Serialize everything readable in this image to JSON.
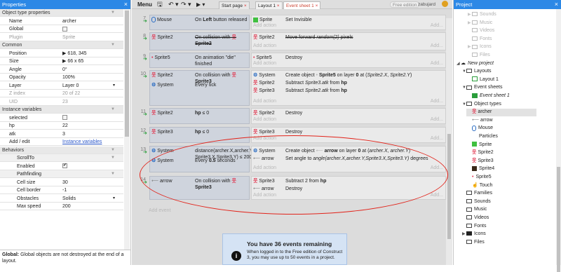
{
  "properties": {
    "title": "Properties",
    "close": "×",
    "rows": [
      {
        "type": "sec",
        "k": "Object type properties"
      },
      {
        "k": "Name",
        "v": "archer"
      },
      {
        "k": "Global",
        "cb": ""
      },
      {
        "k": "Plugin",
        "v": "Sprite",
        "dim": true
      },
      {
        "type": "sec",
        "k": "Common"
      },
      {
        "k": "Position",
        "v": "▶ 618, 345"
      },
      {
        "k": "Size",
        "v": "▶ 66 x 65"
      },
      {
        "k": "Angle",
        "v": "0°"
      },
      {
        "k": "Opacity",
        "v": "100%"
      },
      {
        "k": "Layer",
        "v": "Layer 0",
        "dd": "▾"
      },
      {
        "k": "Z index",
        "v": "20 of 22",
        "dim": true
      },
      {
        "k": "UID",
        "v": "23",
        "dim": true
      },
      {
        "type": "sec",
        "k": "Instance variables"
      },
      {
        "k": "selected",
        "cb": ""
      },
      {
        "k": "hp",
        "v": "22"
      },
      {
        "k": "atk",
        "v": "3"
      },
      {
        "k": "Add / edit",
        "link": "Instance variables"
      },
      {
        "type": "sec",
        "k": "Behaviors"
      },
      {
        "type": "subsec",
        "k": "ScrollTo"
      },
      {
        "k": "Enabled",
        "cb": "✔",
        "sub": true
      },
      {
        "type": "subsec",
        "k": "Pathfinding"
      },
      {
        "k": "Cell size",
        "v": "30",
        "sub": true
      },
      {
        "k": "Cell border",
        "v": "-1",
        "sub": true
      },
      {
        "k": "Obstacles",
        "v": "Solids",
        "dd": "▾",
        "sub": true
      },
      {
        "k": "Max speed",
        "v": "200",
        "sub": true
      }
    ],
    "footer_bold": "Global:",
    "footer_text": " Global objects are not destroyed at the end of a layout."
  },
  "toolbar": {
    "menu": "Menu",
    "save": "🖫",
    "undo": "↶ ▾",
    "redo": "↷ ▾",
    "run": "▶ ▾",
    "tabs": [
      {
        "label": "Start page",
        "close": "×"
      },
      {
        "label": "Layout 1",
        "close": "×"
      },
      {
        "label": "Event sheet 1",
        "close": "×"
      }
    ],
    "free_edition": "Free edition",
    "user": "zabujard"
  },
  "events": [
    {
      "n": "7",
      "conds": [
        {
          "ico": "mouse",
          "obj": "Mouse",
          "text": "On <b>Left</b> button released"
        }
      ],
      "acts": [
        {
          "ico": "sprite",
          "obj": "Sprite",
          "text": "Set Invisible"
        }
      ]
    },
    {
      "n": "8",
      "conds": [
        {
          "ico": "fig",
          "obj": "Sprite2",
          "text": "On collision with <span class=fig>웃</span><br><b>Sprite2</b>",
          "strike": true
        }
      ],
      "acts": [
        {
          "ico": "fig",
          "obj": "Sprite2",
          "text": "Move forward <i>random(2)</i> pixels",
          "strike": true
        }
      ]
    },
    {
      "n": "9",
      "conds": [
        {
          "ico": "dot",
          "obj": "Sprite5",
          "text": "On animation \"die\"<br>finished"
        }
      ],
      "acts": [
        {
          "ico": "dot",
          "obj": "Sprite5",
          "text": "Destroy"
        }
      ]
    },
    {
      "n": "10",
      "conds": [
        {
          "ico": "fig",
          "obj": "Sprite2",
          "text": "On collision with <span class=fig>웃</span><br><b>Sprite3</b>"
        },
        {
          "ico": "gear",
          "obj": "System",
          "text": "Every tick"
        }
      ],
      "acts": [
        {
          "ico": "gear",
          "obj": "System",
          "text": "Create object <span class=dim2>•</span> <b>Sprite5</b> on layer <b>0</b> at (<i>Sprite2.X</i>, <i>Sprite2.Y</i>)"
        },
        {
          "ico": "fig",
          "obj": "Sprite2",
          "text": "Subtract <i>Sprite3.atk</i> from <b>hp</b>"
        },
        {
          "ico": "fig",
          "obj": "Sprite3",
          "text": "Subtract <i>Sprite2.atk</i> from <b>hp</b>"
        }
      ]
    },
    {
      "n": "11",
      "conds": [
        {
          "ico": "fig",
          "obj": "Sprite2",
          "text": "<b>hp</b> ≤ 0"
        }
      ],
      "acts": [
        {
          "ico": "fig",
          "obj": "Sprite2",
          "text": "Destroy"
        }
      ]
    },
    {
      "n": "12",
      "conds": [
        {
          "ico": "fig",
          "obj": "Sprite3",
          "text": "<b>hp</b> ≤ 0"
        }
      ],
      "acts": [
        {
          "ico": "fig",
          "obj": "Sprite3",
          "text": "Destroy"
        }
      ]
    },
    {
      "n": "13",
      "conds": [
        {
          "ico": "gear",
          "obj": "System",
          "text": "distance(archer.X,archer.Y,<br>Sprite3.X,Sprite3.Y) ≤ 200"
        },
        {
          "ico": "gear",
          "obj": "System",
          "text": "Every <b>0.5</b> seconds"
        }
      ],
      "acts": [
        {
          "ico": "gear",
          "obj": "System",
          "text": "Create object <span class=dim2>⟵</span> <b>arrow</b> on layer <b>0</b> at (<i>archer.X</i>, <i>archer.Y</i>)"
        },
        {
          "ico": "arrow",
          "obj": "arrow",
          "text": "Set angle to <i>angle(archer.X,archer.Y,Sprite3.X,Sprite3.Y)</i> degrees"
        }
      ]
    },
    {
      "n": "14",
      "conds": [
        {
          "ico": "arrow",
          "obj": "arrow",
          "text": "On collision with <span class=fig>웃</span><br><b>Sprite3</b>"
        }
      ],
      "acts": [
        {
          "ico": "fig",
          "obj": "Sprite3",
          "text": "Subtract 2 from <b>hp</b>"
        },
        {
          "ico": "arrow",
          "obj": "arrow",
          "text": "Destroy"
        }
      ]
    }
  ],
  "add_action": "Add action",
  "add_event": "Add event",
  "add_right": "Add...",
  "notice": {
    "title": "You have 36 events remaining",
    "text": "When logged in to the Free edition of Construct 3, you may use up to 50 events in a project.",
    "icon": "i"
  },
  "project": {
    "title": "Project",
    "close": "×",
    "items": [
      {
        "label": "Sounds",
        "d": 2,
        "dim": true,
        "caret": "▶"
      },
      {
        "label": "Music",
        "d": 2,
        "dim": true,
        "caret": "▶"
      },
      {
        "label": "Videos",
        "d": 2,
        "dim": true
      },
      {
        "label": "Fonts",
        "d": 2,
        "dim": true
      },
      {
        "label": "Icons",
        "d": 2,
        "dim": true,
        "caret": "▶"
      },
      {
        "label": "Files",
        "d": 2,
        "dim": true
      },
      {
        "label": "New project",
        "d": 0,
        "caret": "◢",
        "it": true,
        "ico": "cloud"
      },
      {
        "label": "Layouts",
        "d": 1,
        "caret": "▼"
      },
      {
        "label": "Layout 1",
        "d": 2,
        "ico": "layout"
      },
      {
        "label": "Event sheets",
        "d": 1,
        "caret": "▼"
      },
      {
        "label": "Event sheet 1",
        "d": 2,
        "ico": "sheet",
        "it": true
      },
      {
        "label": "Object types",
        "d": 1,
        "caret": "▼"
      },
      {
        "label": "archer",
        "d": 2,
        "ico": "fig",
        "sel": true
      },
      {
        "label": "arrow",
        "d": 2,
        "ico": "arrow"
      },
      {
        "label": "Mouse",
        "d": 2,
        "ico": "mouse"
      },
      {
        "label": "Particles",
        "d": 2,
        "ico": "none"
      },
      {
        "label": "Sprite",
        "d": 2,
        "ico": "green"
      },
      {
        "label": "Sprite2",
        "d": 2,
        "ico": "fig"
      },
      {
        "label": "Sprite3",
        "d": 2,
        "ico": "fig"
      },
      {
        "label": "Sprite4",
        "d": 2,
        "ico": "dark"
      },
      {
        "label": "Sprite5",
        "d": 2,
        "ico": "dot"
      },
      {
        "label": "Touch",
        "d": 2,
        "ico": "touch"
      },
      {
        "label": "Families",
        "d": 1
      },
      {
        "label": "Sounds",
        "d": 1
      },
      {
        "label": "Music",
        "d": 1
      },
      {
        "label": "Videos",
        "d": 1
      },
      {
        "label": "Fonts",
        "d": 1
      },
      {
        "label": "Icons",
        "d": 1,
        "caret": "▶",
        "fill": true
      },
      {
        "label": "Files",
        "d": 1
      }
    ]
  }
}
